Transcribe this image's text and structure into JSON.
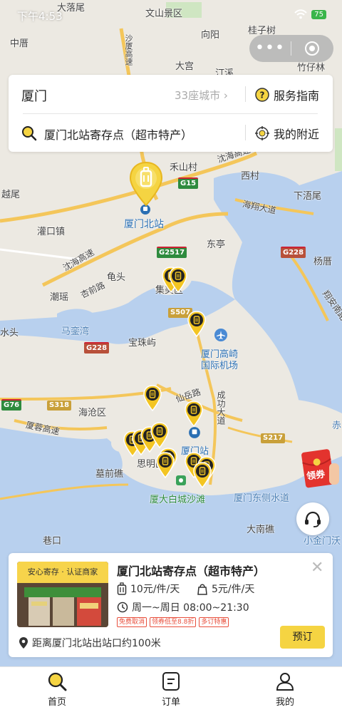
{
  "status_bar": {
    "time": "下午4:53",
    "battery": "75"
  },
  "search": {
    "city": "厦门",
    "city_count": "33座城市",
    "service_guide": "服务指南",
    "query": "厦门北站寄存点（超市特产）",
    "nearby": "我的附近"
  },
  "map": {
    "labels": [
      {
        "text": "大落尾"
      },
      {
        "text": "文山景区"
      },
      {
        "text": "中厝"
      },
      {
        "text": "向阳"
      },
      {
        "text": "桂子树"
      },
      {
        "text": "沙厦高速"
      },
      {
        "text": "大宫"
      },
      {
        "text": "汀溪"
      },
      {
        "text": "竹仔林"
      },
      {
        "text": "禾山村"
      },
      {
        "text": "沈海高速"
      },
      {
        "text": "西村"
      },
      {
        "text": "越尾"
      },
      {
        "text": "下浯尾"
      },
      {
        "text": "海翔大道"
      },
      {
        "text": "灌口镇"
      },
      {
        "text": "东亭"
      },
      {
        "text": "沈海高速"
      },
      {
        "text": "杨厝"
      },
      {
        "text": "龟头"
      },
      {
        "text": "杏前路"
      },
      {
        "text": "集美区"
      },
      {
        "text": "潮瑶"
      },
      {
        "text": "翔安南路"
      },
      {
        "text": "水头"
      },
      {
        "text": "马銮湾"
      },
      {
        "text": "宝珠屿"
      },
      {
        "text": "厦门高崎"
      },
      {
        "text": "国际机场"
      },
      {
        "text": "仙岳路"
      },
      {
        "text": "成功大道"
      },
      {
        "text": "海沧区"
      },
      {
        "text": "厦蓉高速"
      },
      {
        "text": "厦门站"
      },
      {
        "text": "思明区"
      },
      {
        "text": "墓前礁"
      },
      {
        "text": "厦大白城沙滩"
      },
      {
        "text": "厦门东侧水道"
      },
      {
        "text": "大南礁"
      },
      {
        "text": "小金门沃"
      },
      {
        "text": "巷口"
      },
      {
        "text": "赤"
      }
    ],
    "station_label": "厦门北站",
    "road_badges": [
      "G15",
      "G2517",
      "S507",
      "G228",
      "G76",
      "S318",
      "S217",
      "G228"
    ]
  },
  "coupon": {
    "label": "领券"
  },
  "store_card": {
    "tag": "安心寄存 · 认证商家",
    "name": "厦门北站寄存点（超市特产）",
    "price_large": "10元/件/天",
    "price_small": "5元/件/天",
    "hours": "周一~周日 08:00~21:30",
    "badges": [
      "免费取消",
      "领券低至8.8折",
      "多订特惠"
    ],
    "book": "预订",
    "distance": "距离厦门北站出站口约100米"
  },
  "tabbar": {
    "tabs": [
      {
        "label": "首页"
      },
      {
        "label": "订单"
      },
      {
        "label": "我的"
      }
    ]
  },
  "colors": {
    "accent": "#f5d442",
    "water": "#b8d0ee",
    "land": "#ece9e2",
    "pin": "#f3c522"
  }
}
